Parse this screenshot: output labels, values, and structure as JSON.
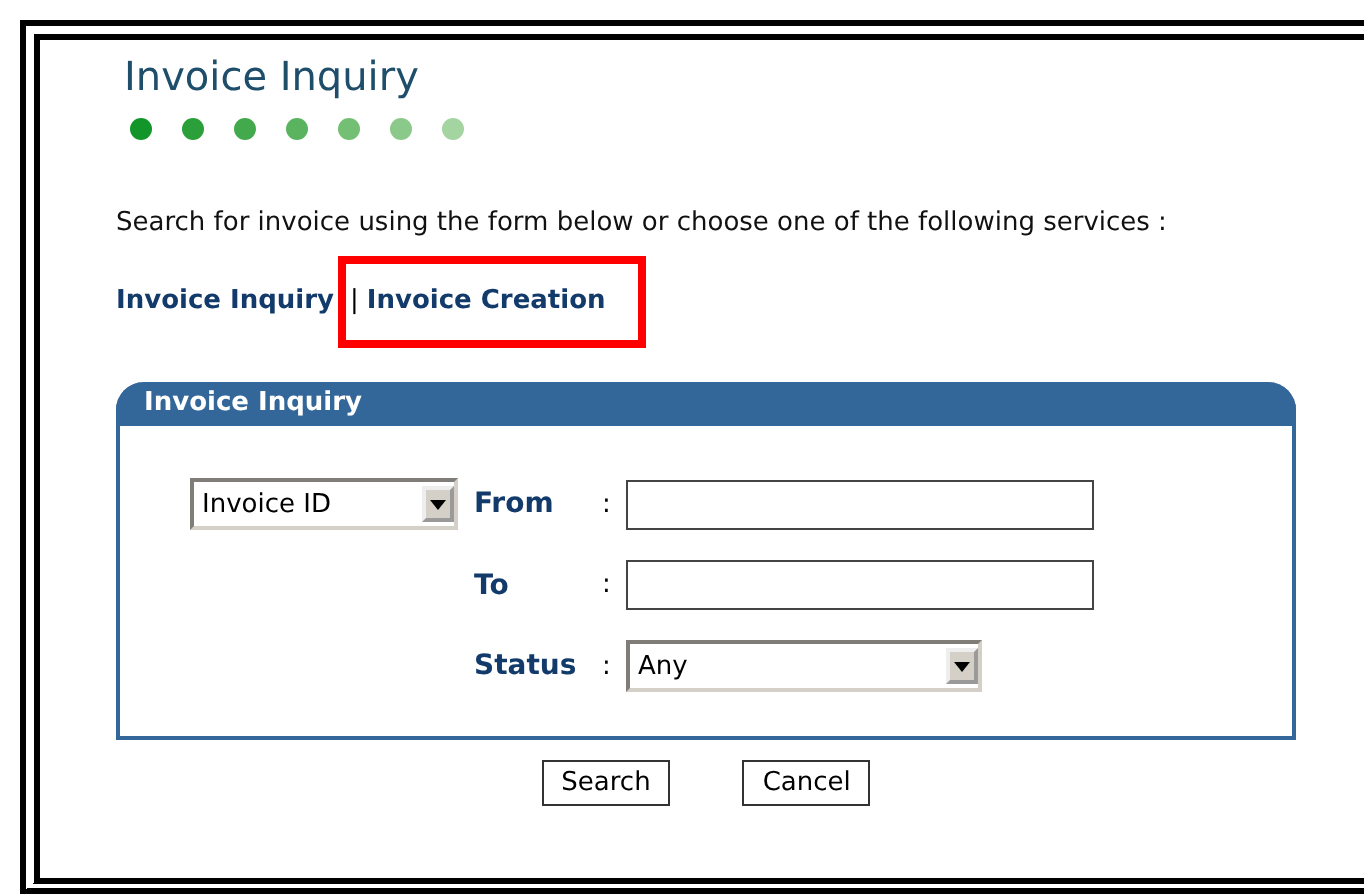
{
  "title": "Invoice Inquiry",
  "progress_dots": [
    {
      "color": "#12962a"
    },
    {
      "color": "#2a9f3a"
    },
    {
      "color": "#42a94c"
    },
    {
      "color": "#5ab35f"
    },
    {
      "color": "#73bf73"
    },
    {
      "color": "#8bc98a"
    },
    {
      "color": "#a4d5a1"
    }
  ],
  "intro": "Search for invoice using the form below or choose one of the following services :",
  "separator": "|",
  "links": [
    {
      "label": "Invoice Inquiry",
      "highlighted": false
    },
    {
      "label": "Invoice Creation",
      "highlighted": true
    }
  ],
  "panel": {
    "title": "Invoice Inquiry",
    "id_select": {
      "value": "Invoice ID"
    },
    "fields": [
      {
        "label": "From",
        "separator": ":",
        "kind": "text"
      },
      {
        "label": "To",
        "separator": ":",
        "kind": "text"
      },
      {
        "label": "Status",
        "separator": ":",
        "kind": "select",
        "value": "Any"
      }
    ]
  },
  "buttons": [
    "Search",
    "Cancel"
  ]
}
